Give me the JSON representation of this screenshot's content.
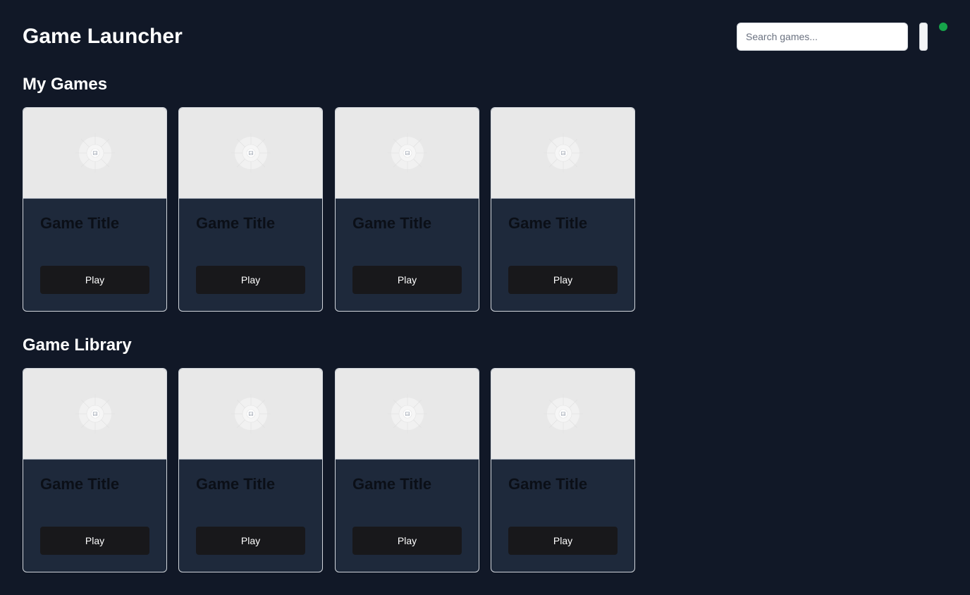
{
  "header": {
    "title": "Game Launcher",
    "search_placeholder": "Search games...",
    "status_color": "#16a34a"
  },
  "sections": [
    {
      "title": "My Games",
      "games": [
        {
          "title": "Game Title",
          "play_label": "Play",
          "thumbnail_icon": "image-placeholder-icon"
        },
        {
          "title": "Game Title",
          "play_label": "Play",
          "thumbnail_icon": "image-placeholder-icon"
        },
        {
          "title": "Game Title",
          "play_label": "Play",
          "thumbnail_icon": "image-placeholder-icon"
        },
        {
          "title": "Game Title",
          "play_label": "Play",
          "thumbnail_icon": "image-placeholder-icon"
        }
      ]
    },
    {
      "title": "Game Library",
      "games": [
        {
          "title": "Game Title",
          "play_label": "Play",
          "thumbnail_icon": "image-placeholder-icon"
        },
        {
          "title": "Game Title",
          "play_label": "Play",
          "thumbnail_icon": "image-placeholder-icon"
        },
        {
          "title": "Game Title",
          "play_label": "Play",
          "thumbnail_icon": "image-placeholder-icon"
        },
        {
          "title": "Game Title",
          "play_label": "Play",
          "thumbnail_icon": "image-placeholder-icon"
        }
      ]
    }
  ]
}
